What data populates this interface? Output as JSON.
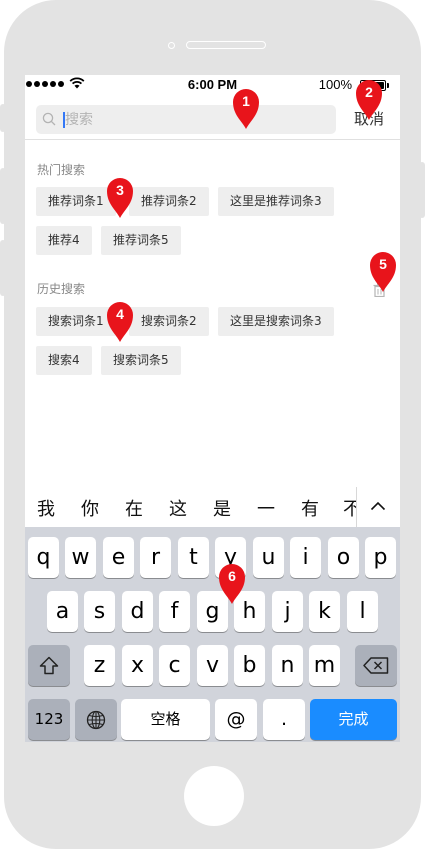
{
  "status_bar": {
    "time": "6:00 PM",
    "battery": "100%"
  },
  "search": {
    "placeholder": "搜索",
    "cancel_label": "取消"
  },
  "hot": {
    "title": "热门搜索",
    "tags": [
      "推荐词条1",
      "推荐词条2",
      "这里是推荐词条3",
      "推荐4",
      "推荐词条5"
    ]
  },
  "history": {
    "title": "历史搜索",
    "tags": [
      "搜索词条1",
      "搜索词条2",
      "这里是搜索词条3",
      "搜索4",
      "搜索词条5"
    ]
  },
  "suggestions": [
    "我",
    "你",
    "在",
    "这",
    "是",
    "一",
    "有",
    "不"
  ],
  "keyboard": {
    "row1": [
      "q",
      "w",
      "e",
      "r",
      "t",
      "y",
      "u",
      "i",
      "o",
      "p"
    ],
    "row2": [
      "a",
      "s",
      "d",
      "f",
      "g",
      "h",
      "j",
      "k",
      "l"
    ],
    "row3": [
      "z",
      "x",
      "c",
      "v",
      "b",
      "n",
      "m"
    ],
    "num_label": "123",
    "space_label": "空格",
    "at_label": "@",
    "dot_label": ".",
    "done_label": "完成"
  },
  "annotations": [
    "1",
    "2",
    "3",
    "4",
    "5",
    "6"
  ],
  "colors": {
    "accent": "#1a8cff",
    "marker": "#e8141b",
    "tag_bg": "#eeeeee",
    "keyboard_bg": "#d1d4db"
  }
}
